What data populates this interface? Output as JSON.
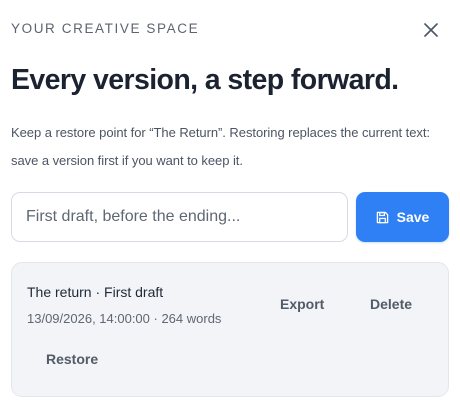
{
  "header": {
    "eyebrow": "YOUR CREATIVE SPACE",
    "close_icon": "close-icon"
  },
  "headline": "Every version, a step forward.",
  "description": "Keep a restore point for “The Return”. Restoring replaces the current text: save a version first if you want to keep it.",
  "form": {
    "name_placeholder": "First draft, before the ending...",
    "name_value": "",
    "save_label": "Save",
    "save_icon": "floppy-disk-icon",
    "accent_color": "#2f80f5"
  },
  "versions": [
    {
      "title": "The return · First draft",
      "meta": "13/09/2026, 14:00:00 · 264 words",
      "export_label": "Export",
      "delete_label": "Delete",
      "restore_label": "Restore"
    }
  ]
}
